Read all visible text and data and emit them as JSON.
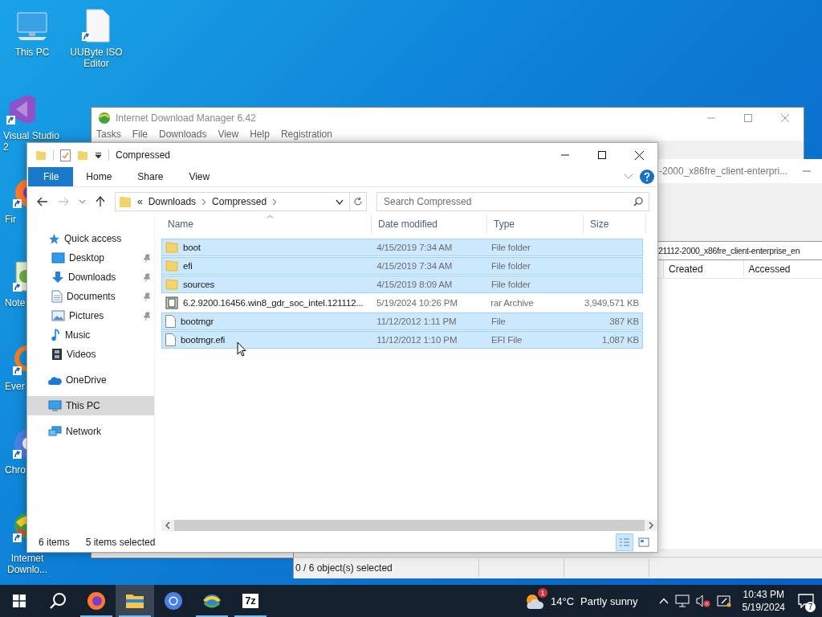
{
  "desktop_icons": [
    {
      "label": "This PC",
      "kind": "pc"
    },
    {
      "label": "Visual Studio 2",
      "kind": "vs"
    },
    {
      "label": "Fir",
      "kind": "firefox"
    },
    {
      "label": "Note",
      "kind": "notepad"
    },
    {
      "label": "Ever",
      "kind": "everything"
    },
    {
      "label": "Chro",
      "kind": "chrome"
    },
    {
      "label": "Internet Downlo...",
      "kind": "idm"
    },
    {
      "label": "UUByte ISO Editor",
      "kind": "file"
    }
  ],
  "idm_window": {
    "title": "Internet Download Manager 6.42",
    "menu": [
      "Tasks",
      "File",
      "Downloads",
      "View",
      "Help",
      "Registration"
    ]
  },
  "archive_window": {
    "title": "-2000_x86fre_client-enterpri...",
    "path": "21112-2000_x86fre_client-enterprise_en",
    "columns": [
      "Created",
      "Accessed"
    ],
    "status": "0 / 6 object(s) selected"
  },
  "explorer": {
    "title": "Compressed",
    "ribbon_tabs": [
      {
        "label": "File",
        "selected": true
      },
      {
        "label": "Home",
        "selected": false
      },
      {
        "label": "Share",
        "selected": false
      },
      {
        "label": "View",
        "selected": false
      }
    ],
    "address": {
      "overflow": "«",
      "segments": [
        "Downloads",
        "Compressed"
      ]
    },
    "search": {
      "placeholder": "Search Compressed"
    },
    "nav": [
      {
        "label": "Quick access",
        "kind": "star",
        "selected": false,
        "children": [
          {
            "label": "Desktop",
            "kind": "desktop",
            "pinned": true,
            "selected": false
          },
          {
            "label": "Downloads",
            "kind": "download",
            "pinned": true,
            "selected": false
          },
          {
            "label": "Documents",
            "kind": "documents",
            "pinned": true,
            "selected": false
          },
          {
            "label": "Pictures",
            "kind": "pictures",
            "pinned": true,
            "selected": false
          },
          {
            "label": "Music",
            "kind": "music",
            "pinned": false,
            "selected": false
          },
          {
            "label": "Videos",
            "kind": "videos",
            "pinned": false,
            "selected": false
          }
        ]
      },
      {
        "label": "OneDrive",
        "kind": "cloud",
        "selected": false
      },
      {
        "label": "This PC",
        "kind": "pc",
        "selected": true
      },
      {
        "label": "Network",
        "kind": "network",
        "selected": false
      }
    ],
    "columns": [
      "Name",
      "Date modified",
      "Type",
      "Size"
    ],
    "files": [
      {
        "name": "boot",
        "date": "4/15/2019 7:34 AM",
        "type": "File folder",
        "kind": "folder",
        "selected": true
      },
      {
        "name": "efi",
        "date": "4/15/2019 7:34 AM",
        "type": "File folder",
        "kind": "folder",
        "selected": true
      },
      {
        "name": "sources",
        "date": "4/15/2019 8:09 AM",
        "type": "File folder",
        "kind": "folder",
        "selected": true
      },
      {
        "name": "6.2.9200.16456.win8_gdr_soc_intel.121112...",
        "date": "5/19/2024 10:26 PM",
        "type": "rar Archive",
        "size": "3,949,571 KB",
        "kind": "archive",
        "selected": false
      },
      {
        "name": "bootmgr",
        "date": "11/12/2012 1:11 PM",
        "type": "File",
        "size": "387 KB",
        "kind": "file",
        "selected": true
      },
      {
        "name": "bootmgr.efi",
        "date": "11/12/2012 1:10 PM",
        "type": "EFI File",
        "size": "1,087 KB",
        "kind": "file",
        "selected": true
      }
    ],
    "status": {
      "count": "6 items",
      "selection": "5 items selected"
    },
    "view_buttons": [
      {
        "kind": "details",
        "selected": true
      },
      {
        "kind": "tiles",
        "selected": false
      }
    ]
  },
  "taskbar": {
    "apps": [
      {
        "kind": "firefox",
        "running": true,
        "selected": false
      },
      {
        "kind": "explorer",
        "running": true,
        "selected": true
      },
      {
        "kind": "chrome",
        "running": false,
        "selected": false
      },
      {
        "kind": "idm",
        "running": true,
        "selected": false
      },
      {
        "kind": "sevenzip",
        "label": "7z",
        "running": true,
        "selected": false
      }
    ],
    "weather": {
      "badge": "1",
      "temperature": "14°C",
      "condition": "Partly sunny"
    },
    "time": "10:43 PM",
    "date": "5/19/2024",
    "notifications": "7"
  }
}
